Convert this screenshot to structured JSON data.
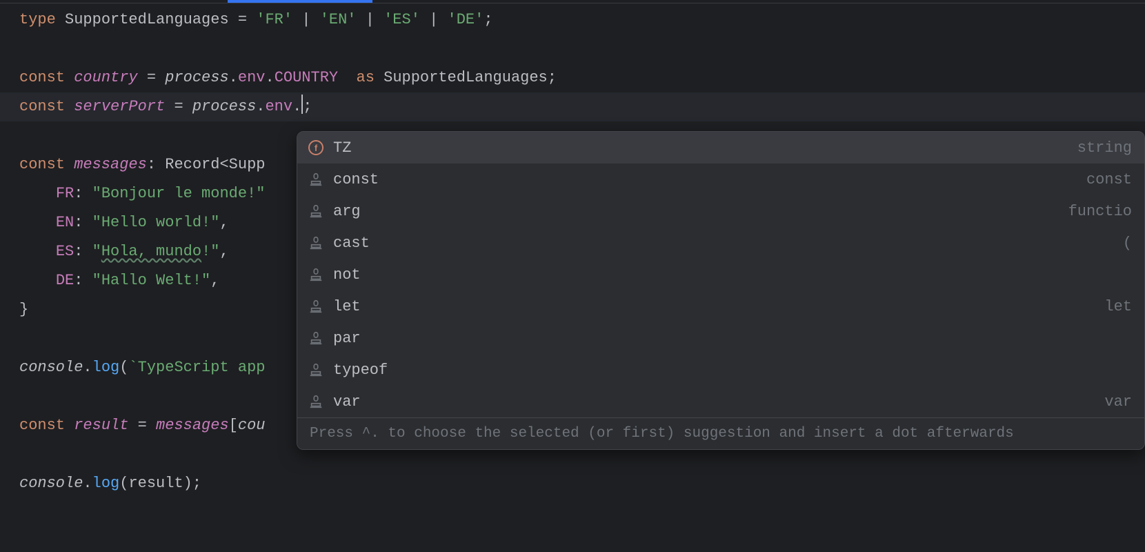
{
  "code": {
    "line1": {
      "kw_type": "type",
      "name": "SupportedLanguages",
      "eq": " = ",
      "v1": "'FR'",
      "pipe": " | ",
      "v2": "'EN'",
      "v3": "'ES'",
      "v4": "'DE'",
      "semi": ";"
    },
    "line3": {
      "kw_const": "const",
      "name": "country",
      "eq": " = ",
      "process": "process",
      "dot": ".",
      "env": "env",
      "dot2": ".",
      "envvar": "COUNTRY",
      "space": "  ",
      "kw_as": "as",
      "typeref": " SupportedLanguages",
      "semi": ";"
    },
    "line4": {
      "kw_const": "const",
      "name": "serverPort",
      "eq": " = ",
      "process": "process",
      "dot": ".",
      "env": "env",
      "dot2": ".",
      "semi": ";"
    },
    "line6": {
      "kw_const": "const",
      "name": "messages",
      "colon": ": ",
      "record": "Record<Supp"
    },
    "line7": {
      "indent": "    ",
      "key": "FR",
      "colon": ": ",
      "val": "\"Bonjour le monde!\""
    },
    "line8": {
      "indent": "    ",
      "key": "EN",
      "colon": ": ",
      "val": "\"Hello world!\"",
      "comma": ","
    },
    "line9": {
      "indent": "    ",
      "key": "ES",
      "colon": ": ",
      "val_open": "\"",
      "val_wavy": "Hola, mundo",
      "val_close": "!\"",
      "comma": ","
    },
    "line10": {
      "indent": "    ",
      "key": "DE",
      "colon": ": ",
      "val": "\"Hallo Welt!\"",
      "comma": ","
    },
    "line11": {
      "brace": "}"
    },
    "line13": {
      "console": "console",
      "dot": ".",
      "log": "log",
      "paren": "(",
      "tmpl": "`TypeScript app"
    },
    "line15": {
      "kw_const": "const",
      "name": "result",
      "eq": " = ",
      "messages": "messages",
      "bracket": "[",
      "country": "cou"
    },
    "line17": {
      "console": "console",
      "dot": ".",
      "log": "log",
      "paren": "(",
      "arg": "result",
      "close": ");"
    }
  },
  "autocomplete": {
    "items": [
      {
        "icon": "field",
        "label": "TZ",
        "type": "string",
        "selected": true
      },
      {
        "icon": "stamp",
        "label": "const",
        "type": "const"
      },
      {
        "icon": "stamp",
        "label": "arg",
        "type": "functio"
      },
      {
        "icon": "stamp",
        "label": "cast",
        "type": "("
      },
      {
        "icon": "stamp",
        "label": "not",
        "type": ""
      },
      {
        "icon": "stamp",
        "label": "let",
        "type": "let"
      },
      {
        "icon": "stamp",
        "label": "par",
        "type": ""
      },
      {
        "icon": "stamp",
        "label": "typeof",
        "type": ""
      },
      {
        "icon": "stamp",
        "label": "var",
        "type": "var"
      }
    ],
    "hint": "Press ^. to choose the selected (or first) suggestion and insert a dot afterwards"
  }
}
